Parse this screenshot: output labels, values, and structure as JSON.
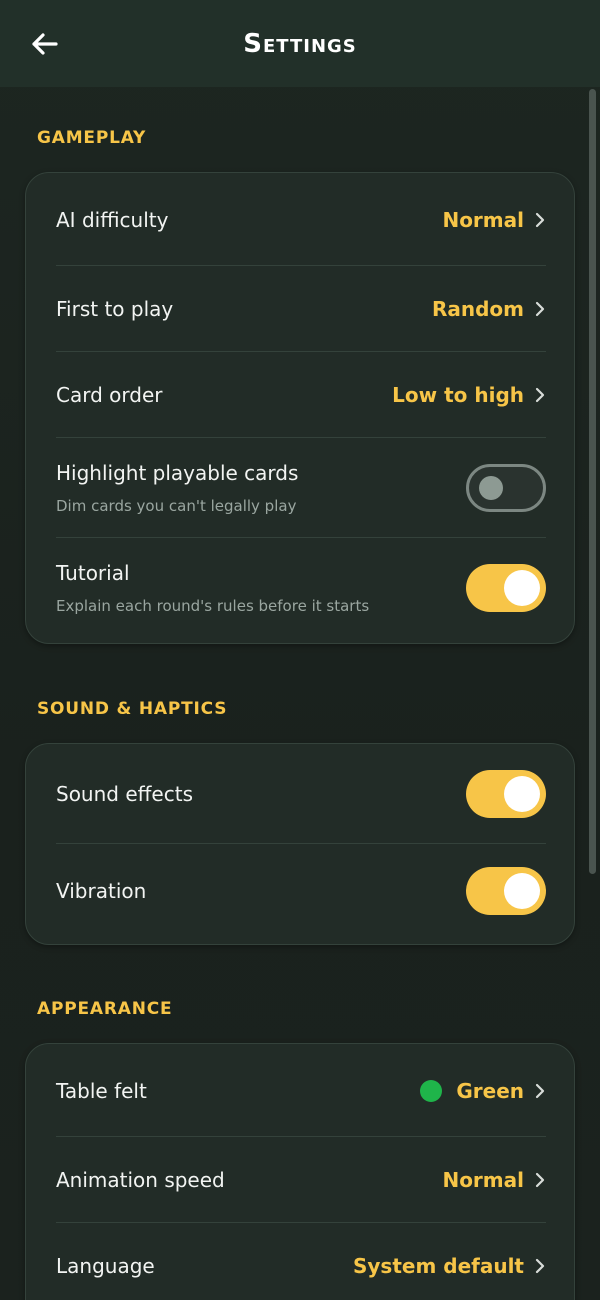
{
  "header": {
    "title": "Settings",
    "back_icon": "arrow-left-icon"
  },
  "colors": {
    "accent": "#f7c548",
    "felt_green": "#1fb54a",
    "card_bg": "#222c27"
  },
  "sections": {
    "gameplay": {
      "label": "GAMEPLAY",
      "ai_difficulty": {
        "label": "AI difficulty",
        "value": "Normal"
      },
      "first_to_play": {
        "label": "First to play",
        "value": "Random"
      },
      "card_order": {
        "label": "Card order",
        "value": "Low to high"
      },
      "highlight": {
        "label": "Highlight playable cards",
        "sub": "Dim cards you can't legally play",
        "state": "off"
      },
      "tutorial": {
        "label": "Tutorial",
        "sub": "Explain each round's rules before it starts",
        "state": "on"
      }
    },
    "sound": {
      "label": "SOUND & HAPTICS",
      "sound_effects": {
        "label": "Sound effects",
        "state": "on"
      },
      "vibration": {
        "label": "Vibration",
        "state": "on"
      }
    },
    "appearance": {
      "label": "APPEARANCE",
      "table_felt": {
        "label": "Table felt",
        "value": "Green"
      },
      "animation_speed": {
        "label": "Animation speed",
        "value": "Normal"
      },
      "language": {
        "label": "Language",
        "value": "System default"
      }
    }
  }
}
